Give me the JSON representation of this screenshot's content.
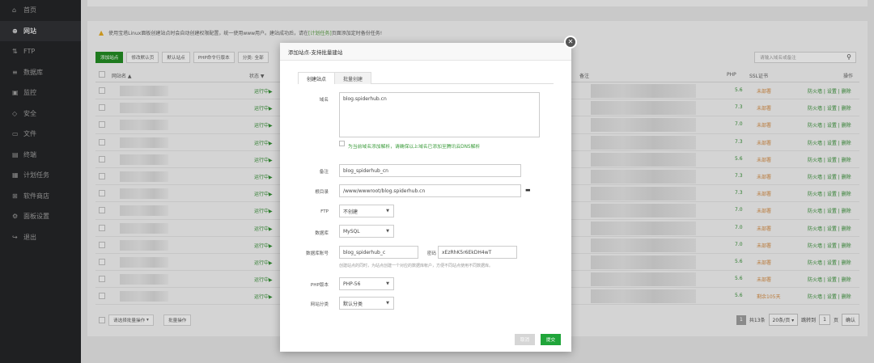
{
  "sidebar": {
    "items": [
      {
        "icon": "home-icon",
        "glyph": "⌂",
        "label": "首页"
      },
      {
        "icon": "globe-icon",
        "glyph": "⊕",
        "label": "网站"
      },
      {
        "icon": "ftp-icon",
        "glyph": "⇅",
        "label": "FTP"
      },
      {
        "icon": "database-icon",
        "glyph": "≡",
        "label": "数据库"
      },
      {
        "icon": "monitor-icon",
        "glyph": "▣",
        "label": "监控"
      },
      {
        "icon": "shield-icon",
        "glyph": "◇",
        "label": "安全"
      },
      {
        "icon": "folder-icon",
        "glyph": "▭",
        "label": "文件"
      },
      {
        "icon": "terminal-icon",
        "glyph": "▤",
        "label": "终端"
      },
      {
        "icon": "calendar-icon",
        "glyph": "▦",
        "label": "计划任务"
      },
      {
        "icon": "grid-icon",
        "glyph": "⊞",
        "label": "软件商店"
      },
      {
        "icon": "settings-icon",
        "glyph": "⚙",
        "label": "面板设置"
      },
      {
        "icon": "logout-icon",
        "glyph": "↪",
        "label": "退出"
      }
    ]
  },
  "notice": {
    "text": "使用宝塔Linux面板创建站点时会自动创建权限配置，统一使用www用户。建站成功后，请在",
    "link": "[计划任务]",
    "tail": "页面添加定时备份任务!"
  },
  "toolbar": {
    "add_site": "添加站点",
    "default_page": "修改默认页",
    "default_site": "默认站点",
    "php_cli": "PHP命令行版本",
    "category": "分类: 全部"
  },
  "search": {
    "placeholder": "请输入域名或备注"
  },
  "table": {
    "headers": {
      "name": "网站名 ▲",
      "status": "状态 ▼",
      "remark": "备注",
      "php": "PHP",
      "ssl": "SSL证书",
      "ops": "操作"
    },
    "rows": [
      {
        "status": "运行中▶",
        "php": "5.6",
        "ssl": "未部署",
        "ops": "防火墙 | 设置 | 删除"
      },
      {
        "status": "运行中▶",
        "php": "7.3",
        "ssl": "未部署",
        "ops": "防火墙 | 设置 | 删除"
      },
      {
        "status": "运行中▶",
        "php": "7.0",
        "ssl": "未部署",
        "ops": "防火墙 | 设置 | 删除"
      },
      {
        "status": "运行中▶",
        "php": "7.3",
        "ssl": "未部署",
        "ops": "防火墙 | 设置 | 删除"
      },
      {
        "status": "运行中▶",
        "php": "5.6",
        "ssl": "未部署",
        "ops": "防火墙 | 设置 | 删除"
      },
      {
        "status": "运行中▶",
        "php": "7.3",
        "ssl": "未部署",
        "ops": "防火墙 | 设置 | 删除"
      },
      {
        "status": "运行中▶",
        "php": "7.3",
        "ssl": "未部署",
        "ops": "防火墙 | 设置 | 删除"
      },
      {
        "status": "运行中▶",
        "php": "7.0",
        "ssl": "未部署",
        "ops": "防火墙 | 设置 | 删除"
      },
      {
        "status": "运行中▶",
        "php": "7.0",
        "ssl": "未部署",
        "ops": "防火墙 | 设置 | 删除"
      },
      {
        "status": "运行中▶",
        "php": "7.0",
        "ssl": "未部署",
        "ops": "防火墙 | 设置 | 删除"
      },
      {
        "status": "运行中▶",
        "php": "5.6",
        "ssl": "未部署",
        "ops": "防火墙 | 设置 | 删除"
      },
      {
        "status": "运行中▶",
        "php": "5.6",
        "ssl": "未部署",
        "ops": "防火墙 | 设置 | 删除"
      },
      {
        "status": "运行中▶",
        "php": "5.6",
        "ssl": "剩余105天",
        "ops": "防火墙 | 设置 | 删除"
      }
    ]
  },
  "batch": {
    "select": "请选择批量操作",
    "button": "批量操作"
  },
  "pagination": {
    "current": "1",
    "total": "共13条",
    "per_page": "20条/页",
    "goto": "跳转到",
    "page_num": "1",
    "page_unit": "页",
    "confirm": "确认"
  },
  "dialog": {
    "title": "添加站点-支持批量建站",
    "tab_create": "创建站点",
    "tab_batch": "批量创建",
    "domain_label": "域名",
    "domain_value": "blog.spiderhub.cn",
    "dns_hint": "为当前域名添加解析，请确保以上域名已添加至腾讯云DNS解析",
    "remark_label": "备注",
    "remark_value": "blog_spiderhub_cn",
    "root_label": "根目录",
    "root_value": "/www/wwwroot/blog.spiderhub.cn",
    "ftp_label": "FTP",
    "ftp_value": "不创建",
    "db_label": "数据库",
    "db_value": "MySQL",
    "dbacct_label": "数据库账号",
    "dbacct_value": "blog_spiderhub_c",
    "pwd_label": "密码",
    "pwd_value": "xEzRhK5r6EkDH4wT",
    "db_hint": "创建站点的同时，为站点创建一个对应的数据库帐户，方便不同站点使用不同数据库。",
    "php_label": "PHP版本",
    "php_value": "PHP-56",
    "cat_label": "网站分类",
    "cat_value": "默认分类",
    "cancel": "取消",
    "submit": "提交"
  }
}
